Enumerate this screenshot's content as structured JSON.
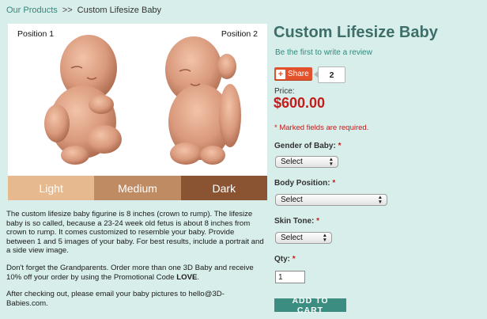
{
  "breadcrumb": {
    "home_label": "Our Products",
    "separator": ">>",
    "current": "Custom Lifesize Baby"
  },
  "image": {
    "position1_label": "Position 1",
    "position2_label": "Position 2",
    "swatches": [
      "Light",
      "Medium",
      "Dark"
    ],
    "swatch_colors": [
      "#e6b98f",
      "#bf8b63",
      "#8a5432"
    ]
  },
  "description": {
    "p1": "The custom lifesize baby figurine is 8 inches (crown to rump).  The lifesize baby is so called, because a 23-24 week old fetus is about 8 inches from crown to rump.  It comes customized to resemble your baby.  Provide between 1 and 5 images of your baby.  For best results, include a portrait and a side view image.",
    "p2_before": "Don't forget the Grandparents.  Order more than one 3D Baby and receive 10% off your order by using the Promotional Code ",
    "p2_code": "LOVE",
    "p2_after": ".",
    "p3": "After checking out, please email your baby pictures to hello@3D-Babies.com."
  },
  "product": {
    "title": "Custom Lifesize Baby",
    "review_link": "Be the first to write a review",
    "share_label": "Share",
    "share_count": "2",
    "price_label": "Price:",
    "price": "$600.00",
    "required_note": "* Marked fields are required."
  },
  "form": {
    "gender_label": "Gender of Baby:",
    "gender_value": "Select",
    "position_label": "Body Position:",
    "position_value": "Select",
    "skin_label": "Skin Tone:",
    "skin_value": "Select",
    "qty_label": "Qty:",
    "qty_value": "1",
    "required_mark": "*",
    "add_to_cart": "ADD TO CART"
  },
  "colors": {
    "background": "#d8eeea",
    "accent": "#3a8d80",
    "price": "#c41b1b",
    "title": "#3e6e6a"
  }
}
